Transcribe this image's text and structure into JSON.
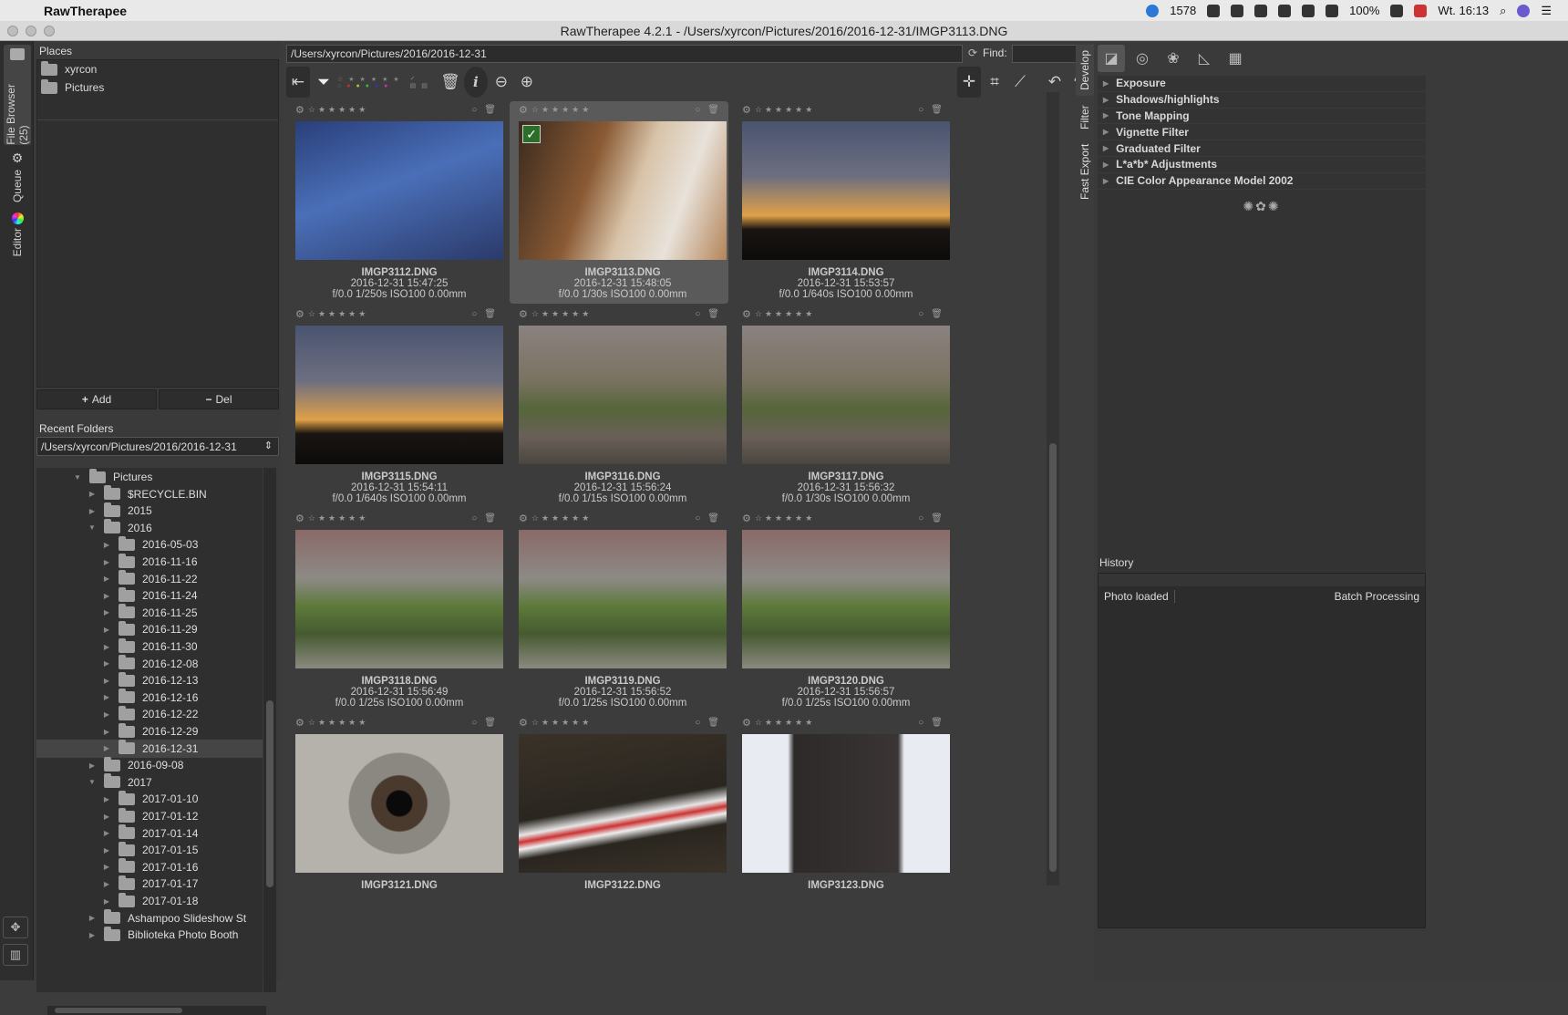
{
  "menubar": {
    "app": "RawTherapee",
    "count": "1578",
    "battery": "100%",
    "clock": "Wt. 16:13"
  },
  "window": {
    "title": "RawTherapee 4.2.1 - /Users/xyrcon/Pictures/2016/2016-12-31/IMGP3113.DNG"
  },
  "side_tabs": {
    "file_browser": "File Browser (25)",
    "queue": "Queue",
    "editor": "Editor"
  },
  "places": {
    "title": "Places",
    "items": [
      {
        "label": "xyrcon"
      },
      {
        "label": "Pictures"
      }
    ],
    "add": "Add",
    "del": "Del"
  },
  "recent": {
    "title": "Recent Folders",
    "value": "/Users/xyrcon/Pictures/2016/2016-12-31"
  },
  "tree": [
    {
      "label": "Pictures",
      "expanded": true
    },
    {
      "label": "$RECYCLE.BIN",
      "expanded": false
    },
    {
      "label": "2015",
      "expanded": false
    },
    {
      "label": "2016",
      "expanded": true
    },
    {
      "label": "2016-05-03",
      "expanded": false
    },
    {
      "label": "2016-11-16",
      "expanded": false
    },
    {
      "label": "2016-11-22",
      "expanded": false
    },
    {
      "label": "2016-11-24",
      "expanded": false
    },
    {
      "label": "2016-11-25",
      "expanded": false
    },
    {
      "label": "2016-11-29",
      "expanded": false
    },
    {
      "label": "2016-11-30",
      "expanded": false
    },
    {
      "label": "2016-12-08",
      "expanded": false
    },
    {
      "label": "2016-12-13",
      "expanded": false
    },
    {
      "label": "2016-12-16",
      "expanded": false
    },
    {
      "label": "2016-12-22",
      "expanded": false
    },
    {
      "label": "2016-12-29",
      "expanded": false
    },
    {
      "label": "2016-12-31",
      "expanded": false,
      "selected": true
    },
    {
      "label": "2016-09-08",
      "expanded": false
    },
    {
      "label": "2017",
      "expanded": true
    },
    {
      "label": "2017-01-10",
      "expanded": false
    },
    {
      "label": "2017-01-12",
      "expanded": false
    },
    {
      "label": "2017-01-14",
      "expanded": false
    },
    {
      "label": "2017-01-15",
      "expanded": false
    },
    {
      "label": "2017-01-16",
      "expanded": false
    },
    {
      "label": "2017-01-17",
      "expanded": false
    },
    {
      "label": "2017-01-18",
      "expanded": false
    },
    {
      "label": "Ashampoo Slideshow St",
      "expanded": false
    },
    {
      "label": "Biblioteka Photo Booth",
      "expanded": false
    }
  ],
  "browser": {
    "path": "/Users/xyrcon/Pictures/2016/2016-12-31",
    "find_label": "Find:",
    "find_value": ""
  },
  "thumbnails": [
    {
      "filename": "IMGP3112.DNG",
      "date": "2016-12-31 15:47:25",
      "exif": "f/0.0 1/250s ISO100 0.00mm",
      "scene": "sky-branches",
      "selected": false
    },
    {
      "filename": "IMGP3113.DNG",
      "date": "2016-12-31 15:48:05",
      "exif": "f/0.0 1/30s ISO100 0.00mm",
      "scene": "tree-trunk",
      "selected": true
    },
    {
      "filename": "IMGP3114.DNG",
      "date": "2016-12-31 15:53:57",
      "exif": "f/0.0 1/640s ISO100 0.00mm",
      "scene": "sunset-trees",
      "selected": false
    },
    {
      "filename": "IMGP3115.DNG",
      "date": "2016-12-31 15:54:11",
      "exif": "f/0.0 1/640s ISO100 0.00mm",
      "scene": "sunset-trees",
      "selected": false
    },
    {
      "filename": "IMGP3116.DNG",
      "date": "2016-12-31 15:56:24",
      "exif": "f/0.0 1/15s ISO100 0.00mm",
      "scene": "ruins-wide",
      "selected": false
    },
    {
      "filename": "IMGP3117.DNG",
      "date": "2016-12-31 15:56:32",
      "exif": "f/0.0 1/30s ISO100 0.00mm",
      "scene": "ruins-wide",
      "selected": false
    },
    {
      "filename": "IMGP3118.DNG",
      "date": "2016-12-31 15:56:49",
      "exif": "f/0.0 1/25s ISO100 0.00mm",
      "scene": "ruins-moss",
      "selected": false
    },
    {
      "filename": "IMGP3119.DNG",
      "date": "2016-12-31 15:56:52",
      "exif": "f/0.0 1/25s ISO100 0.00mm",
      "scene": "ruins-moss",
      "selected": false
    },
    {
      "filename": "IMGP3120.DNG",
      "date": "2016-12-31 15:56:57",
      "exif": "f/0.0 1/25s ISO100 0.00mm",
      "scene": "ruins-moss",
      "selected": false
    },
    {
      "filename": "IMGP3121.DNG",
      "date": "",
      "exif": "",
      "scene": "hole",
      "selected": false
    },
    {
      "filename": "IMGP3122.DNG",
      "date": "",
      "exif": "",
      "scene": "sign-tape",
      "selected": false
    },
    {
      "filename": "IMGP3123.DNG",
      "date": "",
      "exif": "",
      "scene": "chimney",
      "selected": false
    }
  ],
  "right_tabs": {
    "develop": "Develop",
    "filter": "Filter",
    "fast_export": "Fast Export"
  },
  "tools": [
    {
      "label": "Exposure",
      "extra": ""
    },
    {
      "label": "Shadows/highlights",
      "extra": ""
    },
    {
      "label": "Tone Mapping",
      "extra": ""
    },
    {
      "label": "Vignette Filter",
      "extra": ""
    },
    {
      "label": "Graduated Filter",
      "extra": ""
    },
    {
      "label": "L*a*b* Adjustments",
      "extra": ""
    },
    {
      "label": "CIE Color Appearance Model 2002",
      "extra": ""
    }
  ],
  "history": {
    "title": "History",
    "rows": [
      {
        "action": "Photo loaded",
        "note": "Batch Processing"
      }
    ]
  }
}
